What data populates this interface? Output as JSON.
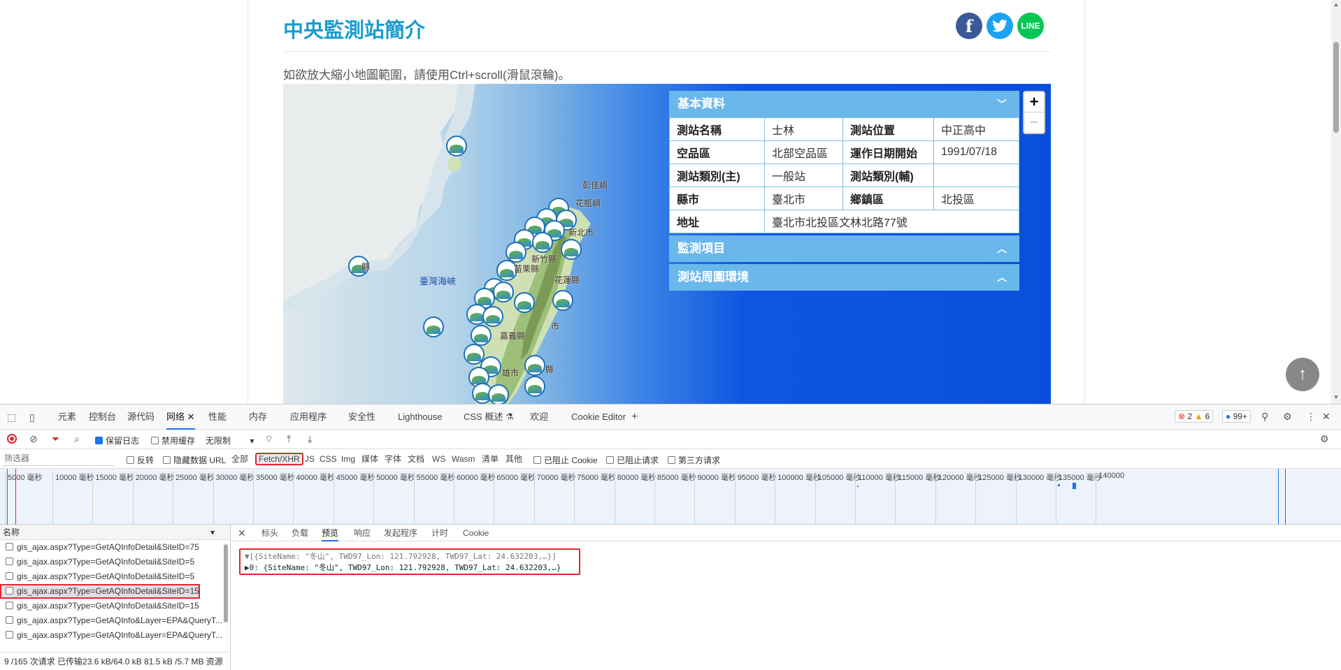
{
  "page": {
    "title": "中央監測站簡介",
    "map_hint": "如欲放大縮小地圖範圍，請使用Ctrl+scroll(滑鼠滾輪)。",
    "social": {
      "facebook": "f",
      "twitter": "🐦",
      "line": "LINE"
    }
  },
  "map": {
    "zoom_in": "+",
    "zoom_out": "−",
    "labels": [
      "彭佳嶼",
      "花瓶嶼",
      "新北市",
      "新竹縣",
      "苗栗縣",
      "花蓮縣",
      "嘉義縣",
      "雄市",
      "縣",
      "縣",
      "市"
    ],
    "sea_label": "臺灣海峽"
  },
  "info_panel": {
    "basic_header": "基本資料",
    "rows": [
      [
        "測站名稱",
        "士林",
        "測站位置",
        "中正高中"
      ],
      [
        "空品區",
        "北部空品區",
        "運作日期開始",
        "1991/07/18"
      ],
      [
        "測站類別(主)",
        "一般站",
        "測站類別(輔)",
        ""
      ],
      [
        "縣市",
        "臺北市",
        "鄉鎮區",
        "北投區"
      ]
    ],
    "address_key": "地址",
    "address_value": "臺北市北投區文林北路77號",
    "monitor_header": "監測項目",
    "env_header": "測站周圍環境",
    "chev_down": "﹀",
    "chev_up": "︿"
  },
  "scroll_top": "↑",
  "devtools": {
    "tabs": [
      "元素",
      "控制台",
      "源代码",
      "网络",
      "性能",
      "内存",
      "应用程序",
      "安全性",
      "Lighthouse",
      "CSS 概述 ⚗",
      "欢迎",
      "Cookie Editor"
    ],
    "badges": {
      "errors": "2",
      "warnings": "6",
      "messages": "99+"
    },
    "toolbar": {
      "preserve_log": "保留日志",
      "disable_cache": "禁用缓存",
      "throttle": "无限制"
    },
    "filter": {
      "placeholder": "筛选器",
      "invert": "反转",
      "hide_data_urls": "隐藏数据 URL",
      "all": "全部",
      "types": [
        "Fetch/XHR",
        "JS",
        "CSS",
        "Img",
        "媒体",
        "字体",
        "文档",
        "WS",
        "Wasm",
        "清单",
        "其他"
      ],
      "blocked_cookies": "已阻止 Cookie",
      "blocked_requests": "已阻止请求",
      "third_party": "第三方请求"
    },
    "timeline_ticks": [
      "5000 毫秒",
      "10000 毫秒",
      "15000 毫秒",
      "20000 毫秒",
      "25000 毫秒",
      "30000 毫秒",
      "35000 毫秒",
      "40000 毫秒",
      "45000 毫秒",
      "50000 毫秒",
      "55000 毫秒",
      "60000 毫秒",
      "65000 毫秒",
      "70000 毫秒",
      "75000 毫秒",
      "80000 毫秒",
      "85000 毫秒",
      "90000 毫秒",
      "95000 毫秒",
      "100000 毫秒",
      "105000 毫秒",
      "110000 毫秒",
      "115000 毫秒",
      "120000 毫秒",
      "125000 毫秒",
      "130000 毫秒",
      "135000 毫秒",
      "140000"
    ],
    "list_header": "名称",
    "requests": [
      "gis_ajax.aspx?Type=GetAQInfoDetail&SiteID=75",
      "gis_ajax.aspx?Type=GetAQInfoDetail&SiteID=5",
      "gis_ajax.aspx?Type=GetAQInfoDetail&SiteID=5",
      "gis_ajax.aspx?Type=GetAQInfoDetail&SiteID=15",
      "gis_ajax.aspx?Type=GetAQInfoDetail&SiteID=15",
      "gis_ajax.aspx?Type=GetAQInfo&Layer=EPA&QueryT...",
      "gis_ajax.aspx?Type=GetAQInfo&Layer=EPA&QueryT..."
    ],
    "detail_tabs": [
      "标头",
      "负载",
      "预览",
      "响应",
      "发起程序",
      "计时",
      "Cookie"
    ],
    "preview": {
      "line1": "▼[{SiteName: \"冬山\", TWD97_Lon: 121.792928, TWD97_Lat: 24.632203,…}]",
      "line2": "  ▶0: {SiteName: \"冬山\", TWD97_Lon: 121.792928, TWD97_Lat: 24.632203,…}"
    },
    "status": "9 /165 次请求  已传输23.6 kB/64.0 kB  81.5 kB /5.7 MB 资源"
  }
}
